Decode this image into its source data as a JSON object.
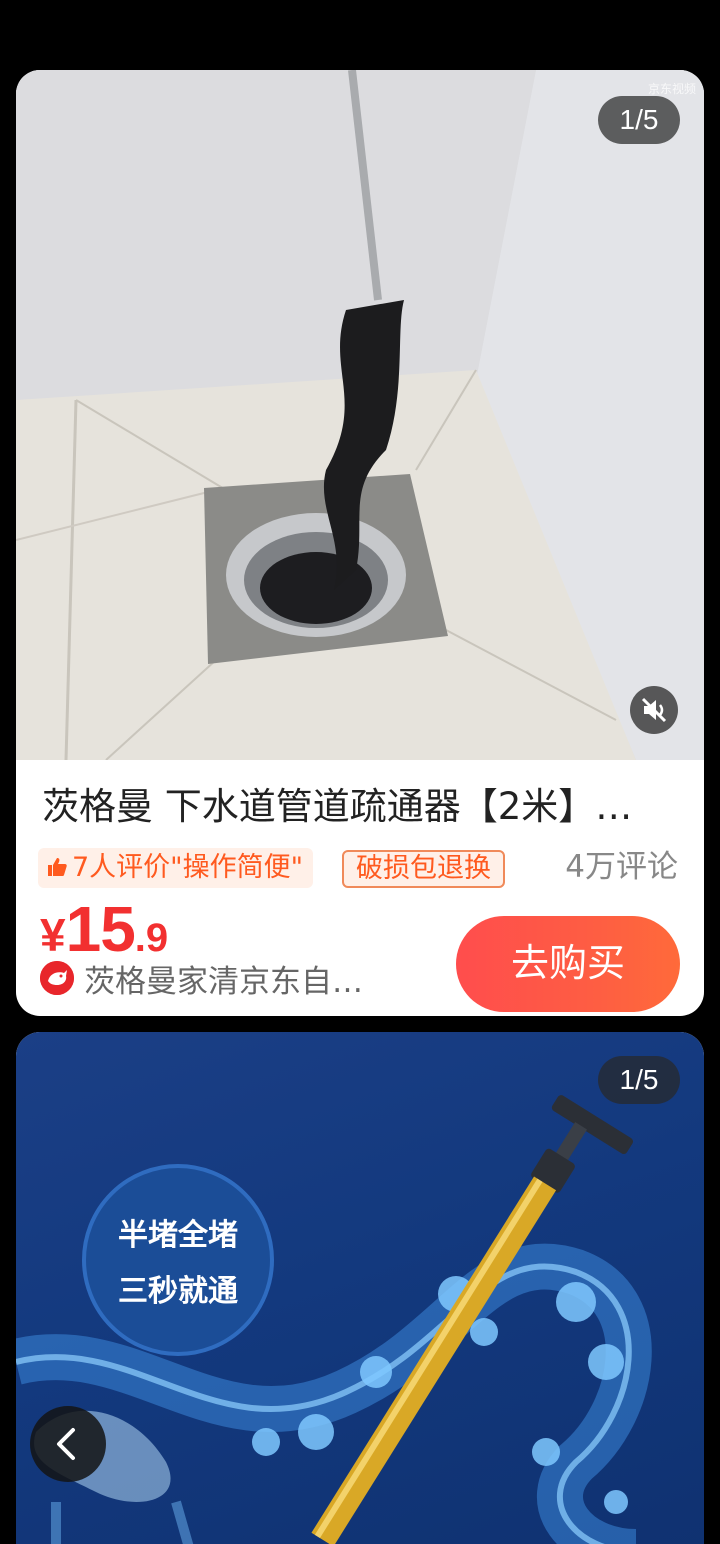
{
  "products": [
    {
      "image_counter": "1/5",
      "video_tag": "京东视频",
      "title": "茨格曼 下水道管道疏通器【2米】…",
      "praise_tag": "7人评价\"操作简便\"",
      "return_tag": "破损包退换",
      "comments": "4万评论",
      "price": {
        "symbol": "¥",
        "integer": "15",
        "decimal": ".9"
      },
      "shop_name": "茨格曼家清京东自…",
      "buy_label": "去购买"
    },
    {
      "image_counter": "1/5",
      "banner_lines": [
        "半堵全堵",
        "三秒就通"
      ]
    }
  ],
  "icons": {
    "thumb": "thumbs-up-icon",
    "mute": "mute-speaker-icon",
    "back": "chevron-left-icon",
    "shop": "jd-dog-logo-icon"
  },
  "colors": {
    "accent": "#f23030",
    "tag_orange": "#ff5a1f",
    "buy_button": "#fe5d43"
  }
}
